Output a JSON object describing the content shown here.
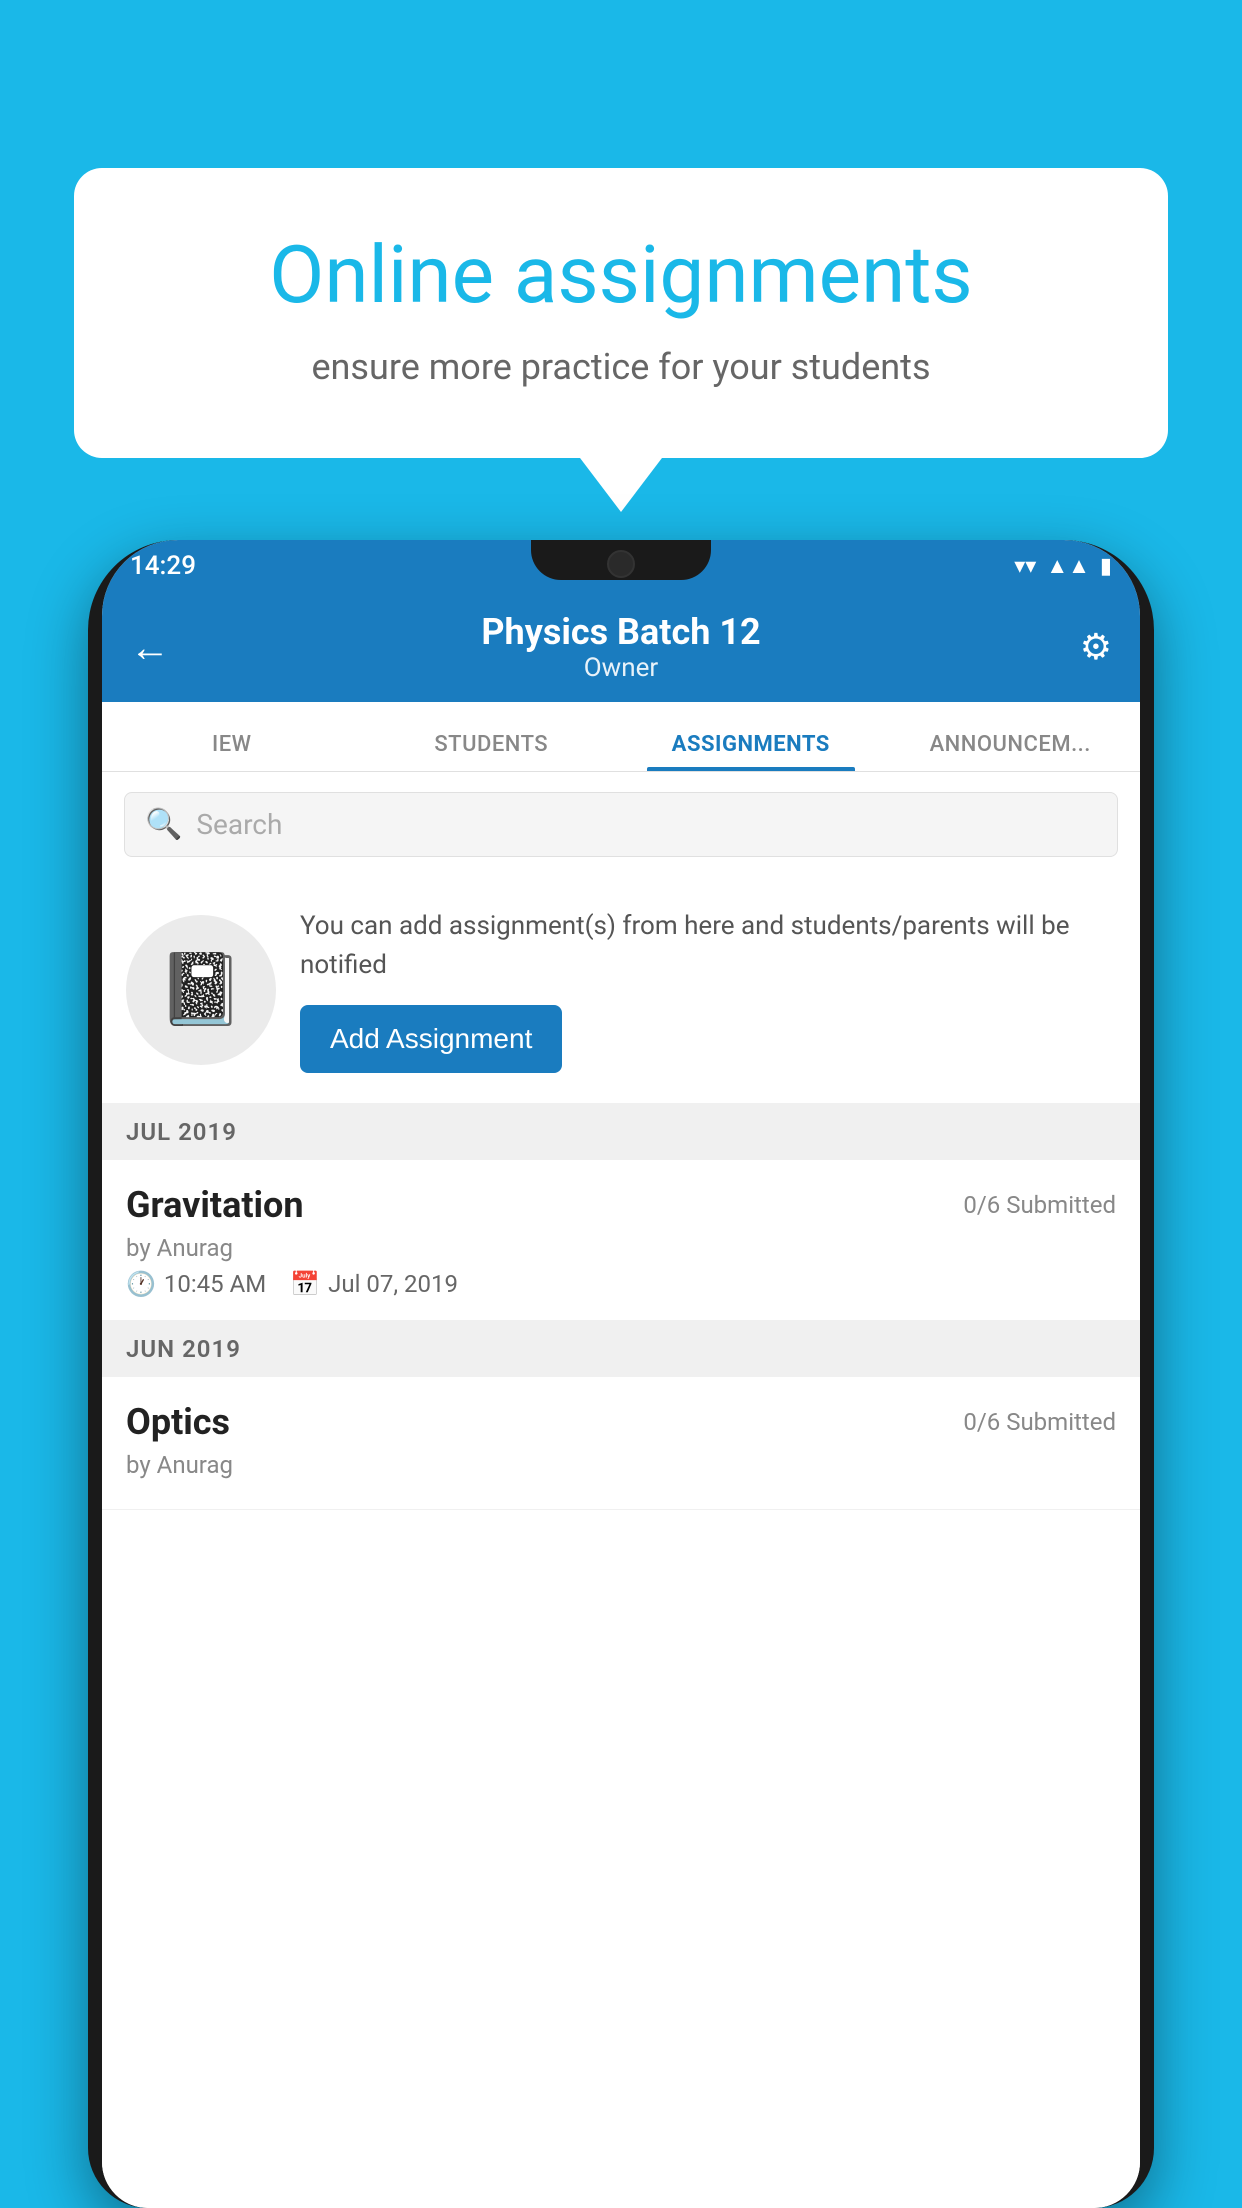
{
  "page": {
    "background_color": "#1ab8e8"
  },
  "speech_bubble": {
    "title": "Online assignments",
    "subtitle": "ensure more practice for your students"
  },
  "status_bar": {
    "time": "14:29",
    "wifi_icon": "▾",
    "signal_icon": "▲",
    "battery_icon": "▮"
  },
  "header": {
    "back_label": "←",
    "title": "Physics Batch 12",
    "subtitle": "Owner",
    "settings_icon": "⚙"
  },
  "tabs": [
    {
      "label": "IEW",
      "active": false
    },
    {
      "label": "STUDENTS",
      "active": false
    },
    {
      "label": "ASSIGNMENTS",
      "active": true
    },
    {
      "label": "ANNOUNCEM...",
      "active": false
    }
  ],
  "search": {
    "placeholder": "Search"
  },
  "promo": {
    "text": "You can add assignment(s) from here and students/parents will be notified",
    "button_label": "Add Assignment"
  },
  "sections": [
    {
      "header": "JUL 2019",
      "assignments": [
        {
          "name": "Gravitation",
          "submitted": "0/6 Submitted",
          "by": "by Anurag",
          "time": "10:45 AM",
          "date": "Jul 07, 2019"
        }
      ]
    },
    {
      "header": "JUN 2019",
      "assignments": [
        {
          "name": "Optics",
          "submitted": "0/6 Submitted",
          "by": "by Anurag",
          "time": "",
          "date": ""
        }
      ]
    }
  ]
}
